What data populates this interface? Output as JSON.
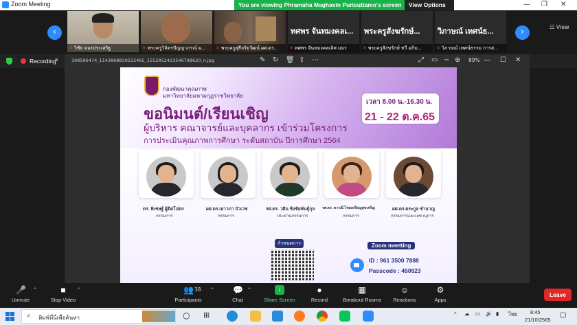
{
  "window": {
    "title": "Zoom Meeting",
    "viewing_banner": "You are viewing Phramaha Maghavin Purisuttamo's screen",
    "view_options": "View Options ⌄",
    "minimize": "—",
    "maximize": "❐",
    "close": "✕"
  },
  "gallery": {
    "view_label": "☷ View",
    "prev": "‹",
    "next": "›",
    "tiles": [
      {
        "name": "วิชัย ทองประเสริฐ",
        "big": ""
      },
      {
        "name": "พระครูวิจิตรปัญญาภรณ์ ผ...",
        "big": ""
      },
      {
        "name": "พระครูสุธีจริยวัฒน์ ผศ.ดร...",
        "big": ""
      },
      {
        "name": "ทศพร จันทมงคลเลิศ มมร",
        "big": "ทศพร จันทมงคลเ..."
      },
      {
        "name": "พระครูสังฆรักษ์ ทวี อภิม...",
        "big": "พระครูสังฆรักษ์..."
      },
      {
        "name": "วิภาษณ์ เทศน์ธรรม การส...",
        "big": "วิภาษณ์ เทศน์ธ..."
      }
    ]
  },
  "sharebar": {
    "recording": "Recording",
    "pause_icon": "⏸"
  },
  "viewer": {
    "filename": "308596474_1143868839552465_1552852423546798620_n.jpg",
    "zoom": "89%",
    "min": "—",
    "max": "☐",
    "close": "✕"
  },
  "poster": {
    "org1": "กองพัฒนาคุณภาพ",
    "org2": "มหาวิทยาลัยมหามกุฏราชวิทยาลัย",
    "head1": "ขอนิมนต์/เรียนเชิญ",
    "head2": "ผู้บริหาร คณาจารย์และบุคลากร เข้าร่วมโครงการ",
    "head3": "การประเมินคุณภาพการศึกษา ระดับสถาบัน ปีการศึกษา 2564",
    "time": "เวลา 8.00 น.-16.30 น.",
    "date": "21 - 22 ต.ค.65",
    "people": [
      {
        "name": "ดร. พิเชษฐ์ ผู้ติดโปตก",
        "role": "กรรมการ"
      },
      {
        "name": "ผศ.ดร.เยาวภา บัวเวช",
        "role": "กรรมการ"
      },
      {
        "name": "รศ.ดร. วศิน ชิงชัยพันธุ์กุล",
        "role": "ประธานกรรมการ"
      },
      {
        "name": "รศ.ดร. ดารณี ไชยเหรียญสุขเจริญ",
        "role": "กรรมการ"
      },
      {
        "name": "ผศ.ดร.ตระกูล ชำนาญ",
        "role": "กรรมการและเลขานุการ"
      }
    ],
    "schedule_tag": "กำหนดการ",
    "zoom_tag": "Zoom meetting",
    "meeting_id": "ID : 961 3500 7888",
    "passcode": "Passcode : 450923"
  },
  "controls": {
    "unmute": "Unmute",
    "stop_video": "Stop Video",
    "participants": "Participants",
    "participants_count": "38",
    "chat": "Chat",
    "share_screen": "Share Screen",
    "record": "Record",
    "breakout": "Breakout Rooms",
    "reactions": "Reactions",
    "apps": "Apps",
    "leave": "Leave"
  },
  "taskbar": {
    "search_placeholder": "พิมพ์ที่นี่เพื่อค้นหา",
    "lang": "ไทย",
    "time": "8:45",
    "date": "21/10/2565"
  },
  "colors": {
    "zoom_blue": "#2d8cff",
    "share_green": "#19b34a",
    "leave_red": "#e02828",
    "poster_purple": "#7a1f7b"
  }
}
